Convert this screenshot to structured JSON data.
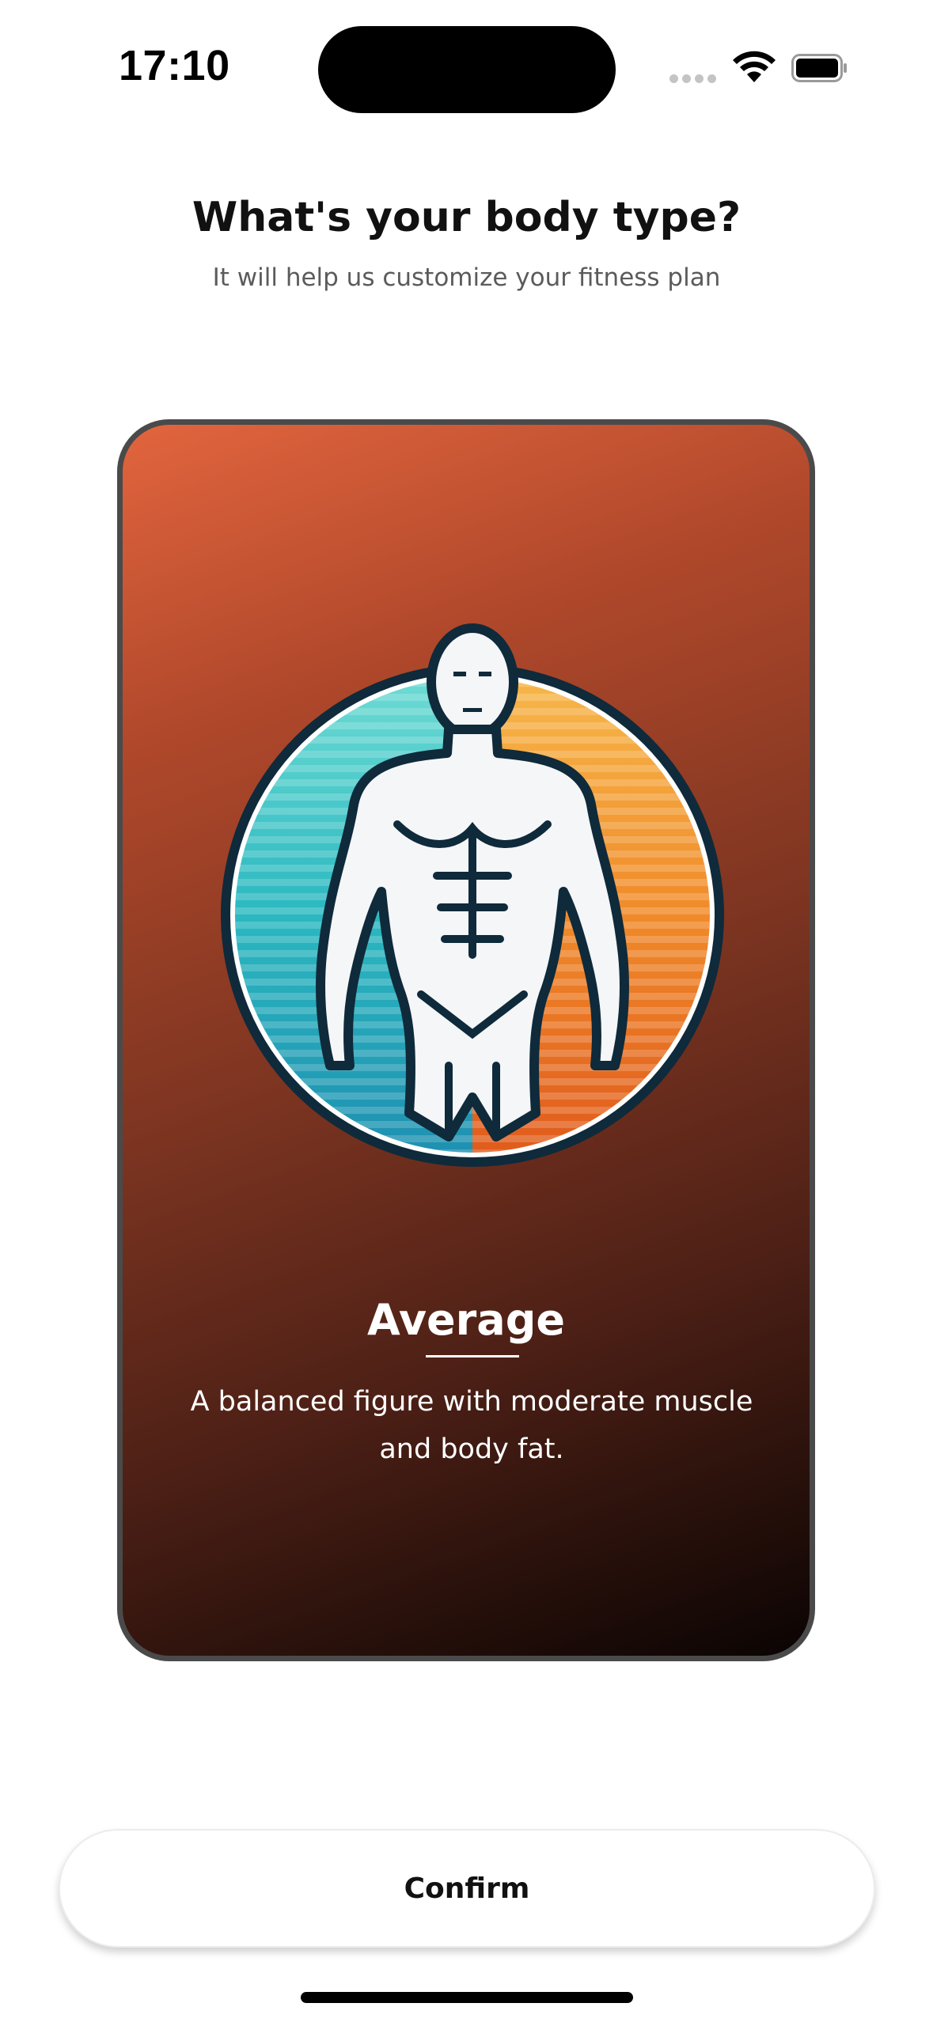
{
  "status_bar": {
    "time": "17:10",
    "icons": [
      "cellular-signal-icon",
      "wifi-icon",
      "battery-icon"
    ]
  },
  "header": {
    "title": "What's your body type?",
    "subtitle": "It will help us customize your fitness plan"
  },
  "card": {
    "image_icon": "muscular-body-figure-icon",
    "name": "Average",
    "description": "A balanced figure with moderate muscle and body fat.",
    "colors": {
      "gradient_top": "#e2653e",
      "gradient_bottom": "#0a0403",
      "border": "#4a4a4a"
    }
  },
  "actions": {
    "confirm_label": "Confirm"
  }
}
